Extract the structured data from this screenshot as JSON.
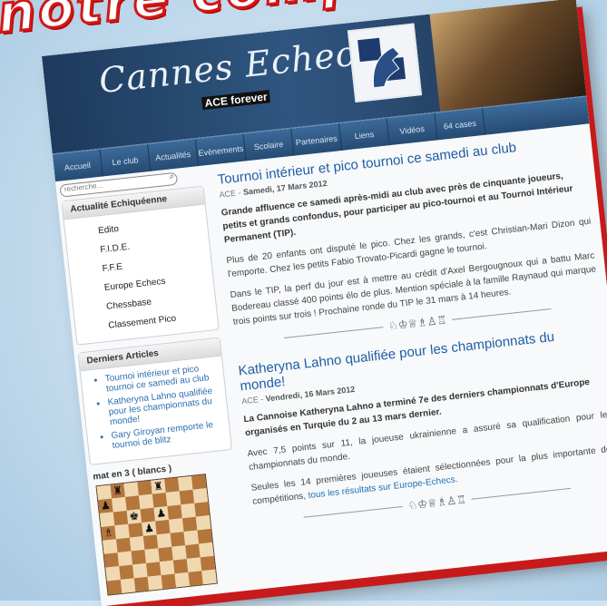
{
  "overlay_text": "notre comp",
  "site": {
    "title": "Cannes Echecs",
    "tagline": "ACE forever"
  },
  "nav": [
    "Accueil",
    "Le club",
    "Actualités",
    "Evènements",
    "Scolaire",
    "Partenaires",
    "Liens",
    "Vidéos",
    "64 cases"
  ],
  "search": {
    "placeholder": "recherche..."
  },
  "sidebar": {
    "actualite_title": "Actualité Echiquéenne",
    "actualite_items": [
      "Edito",
      "F.I.D.E.",
      "F.F.E",
      "Europe Echecs",
      "Chessbase",
      "Classement Pico"
    ],
    "derniers_title": "Derniers Articles",
    "derniers_items": [
      "Tournoi intérieur et pico tournoi ce samedi au club",
      "Katheryna Lahno qualifiée pour les championnats du monde!",
      "Gary Giroyan remporte le tournoi de blitz"
    ],
    "puzzle_title": "mat en 3 ( blancs )"
  },
  "posts": [
    {
      "title": "Tournoi intérieur et pico tournoi ce samedi au club",
      "author": "ACE",
      "date": "Samedi, 17 Mars 2012",
      "lead": "Grande affluence ce samedi après-midi au club avec près de cinquante joueurs, petits et grands confondus, pour participer au pico-tournoi et au Tournoi Intérieur Permanent (TIP).",
      "p1": "Plus de 20 enfants ont disputé le pico. Chez les grands, c'est Christian-Mari Dizon qui l'emporte. Chez les petits Fabio Trovato-Picardi gagne le tournoi.",
      "p2": "Dans le TIP, la perf du jour est à mettre au crédit d'Axel Bergougnoux qui a battu Marc Bodereau classé 400 points élo de plus. Mention spéciale à la famille Raynaud qui marque trois points sur trois ! Prochaine ronde du TIP le 31 mars à 14 heures."
    },
    {
      "title": "Katheryna Lahno qualifiée pour les championnats du monde!",
      "author": "ACE",
      "date": "Vendredi, 16 Mars 2012",
      "lead": "La Cannoise Katheryna Lahno a terminé 7e des derniers championnats d'Europe organisés en Turquie du 2 au 13 mars dernier.",
      "p1": "Avec 7,5 points sur 11, la joueuse ukrainienne a assuré sa qualification pour les championnats du monde.",
      "p2": "Seules les 14 premières joueuses étaient sélectionnées pour la plus importante des compétitions,",
      "p2_link": "tous les résultats sur Europe-Echecs."
    }
  ],
  "separator": "♘♔♕♗♙♖",
  "board_rows": [
    "· ♜ · · ♜ · · ·",
    "♟ · · · · · · ·",
    "· · ♚ · ♟ · · ·",
    "♗ · · ♟ · · · ·",
    "· · · · · · · ·",
    "· · · · · · · ·",
    "· · · · · · · ·",
    "· · · · · · · ·"
  ],
  "colors": {
    "accent": "#1f5ea4",
    "header": "#2b4c74",
    "frame_shadow": "#c71a1a"
  }
}
